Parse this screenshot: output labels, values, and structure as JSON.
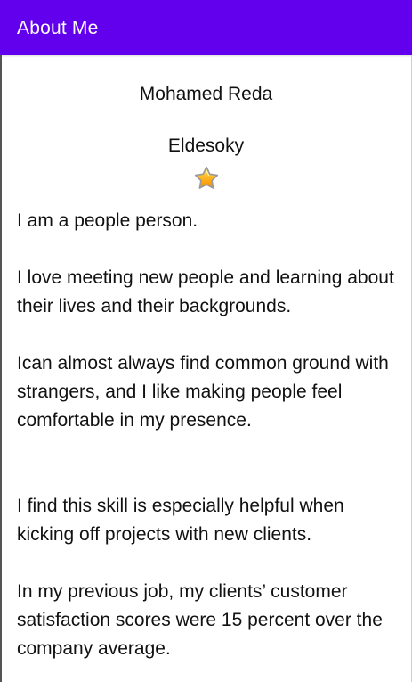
{
  "app_bar": {
    "title": "About Me",
    "background_color": "#6200ee"
  },
  "profile": {
    "first_name": "Mohamed Reda",
    "last_name": "Eldesoky",
    "icon": "star-icon"
  },
  "bio": {
    "text": "I am a people person.\n\nI love meeting new people and learning about their lives and their backgrounds.\n\nIcan almost always find common ground with strangers, and I like making people feel comfortable in my presence.\n\n\nI find this skill is especially helpful when kicking off projects with new clients.\n\nIn my previous job, my clients’ customer satisfaction scores were 15 percent over the company average."
  }
}
